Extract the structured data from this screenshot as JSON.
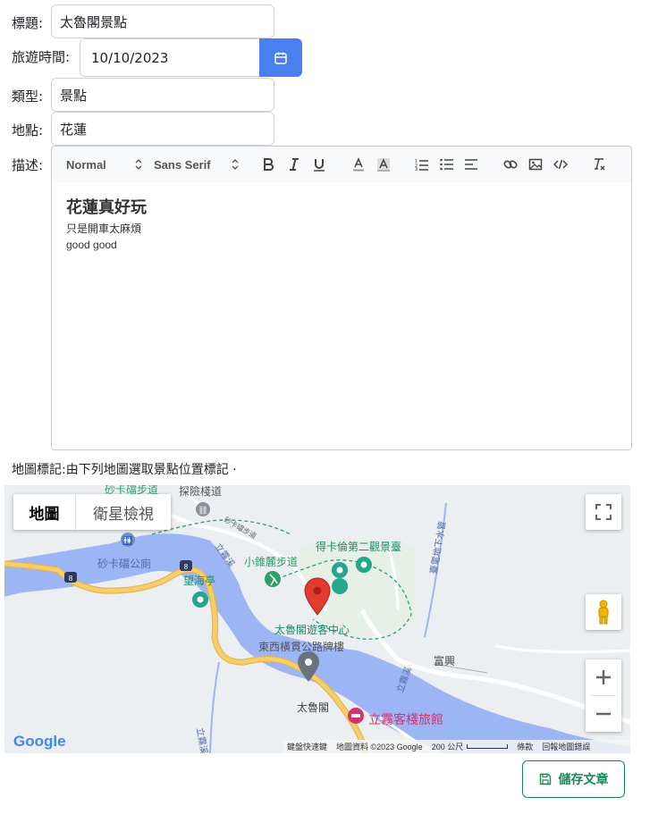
{
  "form": {
    "title_label": "標題:",
    "title_value": "太魯閣景點",
    "date_label": "旅遊時間:",
    "date_value": "10/10/2023",
    "type_label": "類型:",
    "type_value": "景點",
    "place_label": "地點:",
    "place_value": "花蓮",
    "desc_label": "描述:"
  },
  "editor": {
    "format_select": "Normal",
    "font_select": "Sans Serif",
    "heading": "花蓮真好玩",
    "line1": "只是開車太麻煩",
    "line2": "good good"
  },
  "map_section": {
    "label": "地圖標記:由下列地圖選取景點位置標記 ·"
  },
  "map": {
    "tab_map": "地圖",
    "tab_satellite": "衛星檢視",
    "places": {
      "trail_top": "砂卡礑步道",
      "adventure_trail": "探險棧道",
      "sakadang_toilet": "砂卡礑公廁",
      "lookout": "得卡倫第二觀景臺",
      "small_trail": "小錐麓步道",
      "sea_pavilion": "望海亭",
      "visitor_center": "太魯閣遊客中心",
      "arch": "東西橫貫公路牌樓",
      "fuxing": "富興",
      "taroko": "太魯閣",
      "inn": "立霧客棧旅館",
      "river1": "立霧溪",
      "river2": "立霧溪",
      "river3": "立霧溪",
      "tunnel": "臺電地下水管",
      "road8a": "8",
      "road8b": "8",
      "small_road": "砂卡礑步道"
    },
    "footer": {
      "shortcuts": "鍵盤快速鍵",
      "data": "地圖資料 ©2023 Google",
      "scale": "200 公尺",
      "terms": "條款",
      "report": "回報地圖錯誤"
    },
    "google_logo": "Google",
    "colors": {
      "water": "#9bb5f5",
      "road_major": "#f6cf6a",
      "pin": "#e33b2e",
      "park": "#2e9e6b",
      "inn": "#d6336c"
    }
  },
  "save_button": "儲存文章",
  "colors": {
    "primary": "#4a7ff0",
    "success": "#198754"
  }
}
